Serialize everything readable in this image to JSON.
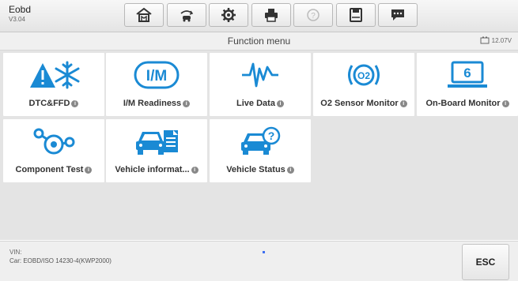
{
  "header": {
    "app_name": "Eobd",
    "version": "V3.04"
  },
  "toolbar": [
    {
      "icon": "home-icon"
    },
    {
      "icon": "vehicle-swap-icon"
    },
    {
      "icon": "gear-icon"
    },
    {
      "icon": "printer-icon"
    },
    {
      "icon": "help-icon",
      "disabled": true
    },
    {
      "icon": "save-icon"
    },
    {
      "icon": "feedback-icon"
    }
  ],
  "subheader": {
    "title": "Function menu",
    "battery": "12.07V"
  },
  "functions": [
    {
      "label": "DTC&FFD",
      "icon": "dtc-ffd-icon"
    },
    {
      "label": "I/M Readiness",
      "icon": "im-readiness-icon",
      "icon_text": "I/M"
    },
    {
      "label": "Live Data",
      "icon": "live-data-icon"
    },
    {
      "label": "O2 Sensor Monitor",
      "icon": "o2-sensor-icon",
      "icon_text": "O2"
    },
    {
      "label": "On-Board Monitor",
      "icon": "onboard-monitor-icon",
      "icon_text": "6"
    },
    {
      "label": "Component Test",
      "icon": "component-test-icon"
    },
    {
      "label": "Vehicle informat...",
      "icon": "vehicle-info-icon"
    },
    {
      "label": "Vehicle Status",
      "icon": "vehicle-status-icon"
    }
  ],
  "footer": {
    "vin_label": "VIN:",
    "car": "Car: EOBD/ISO 14230-4(KWP2000)",
    "esc_label": "ESC"
  },
  "colors": {
    "accent": "#1a8ad4",
    "tile_bg": "#ffffff",
    "grid_bg": "#e4e4e4"
  }
}
